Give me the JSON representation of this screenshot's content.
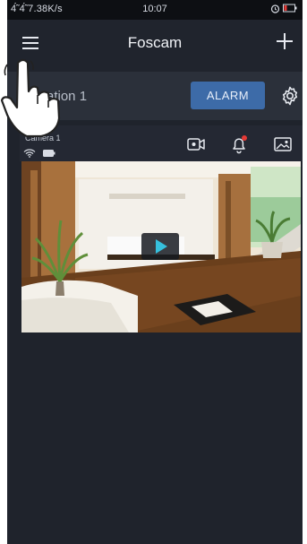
{
  "statusbar": {
    "signal_text": "4̃́ 4̃́ 7.38K/s",
    "time": "10:07"
  },
  "header": {
    "title": "Foscam"
  },
  "location": {
    "name": "ation 1",
    "alarm_label": "ALARM"
  },
  "camera": {
    "name": "Camera 1"
  },
  "colors": {
    "background": "#1f232c",
    "alarm_button": "#3d6ba8",
    "play_accent": "#36c0dd",
    "notification_dot": "#e53935"
  }
}
